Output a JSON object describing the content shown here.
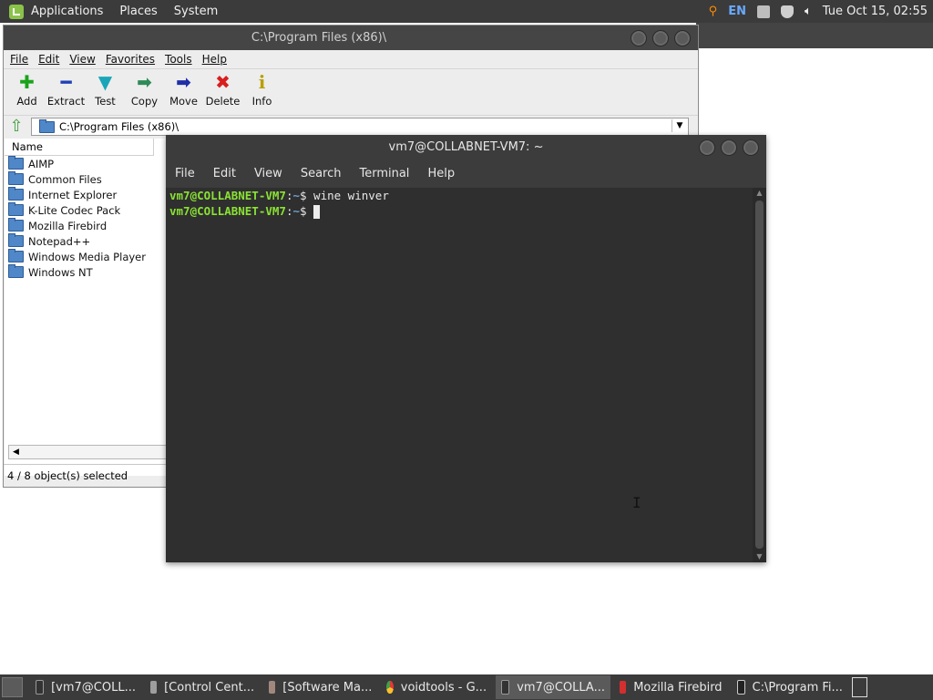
{
  "top_panel": {
    "menus": [
      "Applications",
      "Places",
      "System"
    ],
    "language": "EN",
    "clock": "Tue Oct 15, 02:55"
  },
  "file_manager": {
    "title": "C:\\Program Files (x86)\\",
    "menu": [
      "File",
      "Edit",
      "View",
      "Favorites",
      "Tools",
      "Help"
    ],
    "toolbar": [
      {
        "label": "Add",
        "icon": "plus-icon",
        "color": "#1aa31a"
      },
      {
        "label": "Extract",
        "icon": "minus-icon",
        "color": "#1f3fb5"
      },
      {
        "label": "Test",
        "icon": "check-icon",
        "color": "#1aa6b8"
      },
      {
        "label": "Copy",
        "icon": "double-arrow-icon",
        "color": "#2e8b57"
      },
      {
        "label": "Move",
        "icon": "arrow-right-icon",
        "color": "#1f2fa8"
      },
      {
        "label": "Delete",
        "icon": "x-icon",
        "color": "#d91e1e"
      },
      {
        "label": "Info",
        "icon": "info-icon",
        "color": "#b8a000"
      }
    ],
    "address": "C:\\Program Files (x86)\\",
    "column_name": "Name",
    "items": [
      "AIMP",
      "Common Files",
      "Internet Explorer",
      "K-Lite Codec Pack",
      "Mozilla Firebird",
      "Notepad++",
      "Windows Media Player",
      "Windows NT"
    ],
    "status": "4 / 8 object(s) selected"
  },
  "terminal": {
    "title": "vm7@COLLABNET-VM7: ~",
    "menu": [
      "File",
      "Edit",
      "View",
      "Search",
      "Terminal",
      "Help"
    ],
    "lines": [
      {
        "user": "vm7@COLLABNET-VM7",
        "path": "~",
        "command": " wine winver"
      },
      {
        "user": "vm7@COLLABNET-VM7",
        "path": "~",
        "command": " "
      }
    ]
  },
  "taskbar": {
    "items": [
      {
        "label": "[vm7@COLL...",
        "icon": "terminal-icon",
        "active": false
      },
      {
        "label": "[Control Cent...",
        "icon": "control-center-icon",
        "active": false
      },
      {
        "label": "[Software Ma...",
        "icon": "software-manager-icon",
        "active": false
      },
      {
        "label": "voidtools - G...",
        "icon": "chrome-icon",
        "active": false
      },
      {
        "label": "vm7@COLLA...",
        "icon": "terminal-icon",
        "active": true
      },
      {
        "label": "Mozilla Firebird",
        "icon": "firebird-icon",
        "active": false
      },
      {
        "label": "C:\\Program Fi...",
        "icon": "7zip-icon",
        "active": false
      }
    ]
  },
  "colors": {
    "prompt_user": "#8ae234",
    "prompt_path": "#729fcf",
    "panel_bg": "#3b3b3b"
  }
}
